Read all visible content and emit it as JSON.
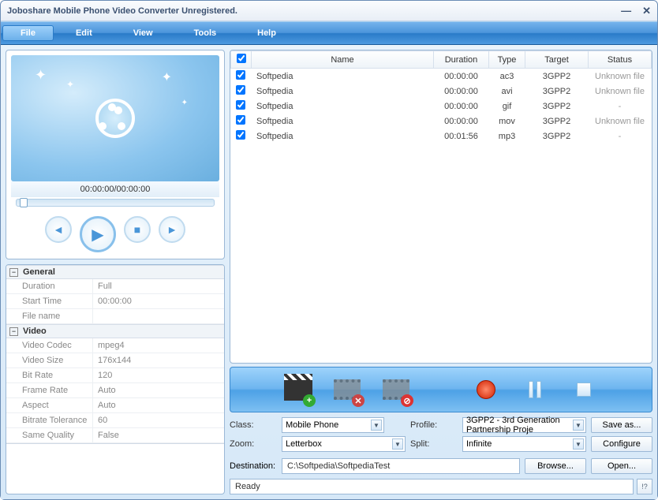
{
  "window": {
    "title": "Joboshare Mobile Phone Video Converter Unregistered."
  },
  "menu": {
    "file": "File",
    "edit": "Edit",
    "view": "View",
    "tools": "Tools",
    "help": "Help"
  },
  "preview": {
    "time": "00:00:00/00:00:00"
  },
  "props": {
    "general": {
      "title": "General",
      "rows": [
        {
          "k": "Duration",
          "v": "Full"
        },
        {
          "k": "Start Time",
          "v": "00:00:00"
        },
        {
          "k": "File name",
          "v": ""
        }
      ]
    },
    "video": {
      "title": "Video",
      "rows": [
        {
          "k": "Video Codec",
          "v": "mpeg4"
        },
        {
          "k": "Video Size",
          "v": "176x144"
        },
        {
          "k": "Bit Rate",
          "v": "120"
        },
        {
          "k": "Frame Rate",
          "v": "Auto"
        },
        {
          "k": "Aspect",
          "v": "Auto"
        },
        {
          "k": "Bitrate Tolerance",
          "v": "60"
        },
        {
          "k": "Same Quality",
          "v": "False"
        }
      ]
    }
  },
  "table": {
    "headers": {
      "name": "Name",
      "duration": "Duration",
      "type": "Type",
      "target": "Target",
      "status": "Status"
    },
    "rows": [
      {
        "name": "Softpedia",
        "duration": "00:00:00",
        "type": "ac3",
        "target": "3GPP2",
        "status": "Unknown file"
      },
      {
        "name": "Softpedia",
        "duration": "00:00:00",
        "type": "avi",
        "target": "3GPP2",
        "status": "Unknown file"
      },
      {
        "name": "Softpedia",
        "duration": "00:00:00",
        "type": "gif",
        "target": "3GPP2",
        "status": "-"
      },
      {
        "name": "Softpedia",
        "duration": "00:00:00",
        "type": "mov",
        "target": "3GPP2",
        "status": "Unknown file"
      },
      {
        "name": "Softpedia",
        "duration": "00:01:56",
        "type": "mp3",
        "target": "3GPP2",
        "status": "-"
      }
    ]
  },
  "settings": {
    "class_label": "Class:",
    "class_value": "Mobile Phone",
    "profile_label": "Profile:",
    "profile_value": "3GPP2 - 3rd Generation Partnership Proje",
    "saveas": "Save as...",
    "zoom_label": "Zoom:",
    "zoom_value": "Letterbox",
    "split_label": "Split:",
    "split_value": "Infinite",
    "configure": "Configure",
    "destination_label": "Destination:",
    "destination_value": "C:\\Softpedia\\SoftpediaTest",
    "browse": "Browse...",
    "open": "Open..."
  },
  "status": {
    "msg": "Ready",
    "help": "!?"
  }
}
